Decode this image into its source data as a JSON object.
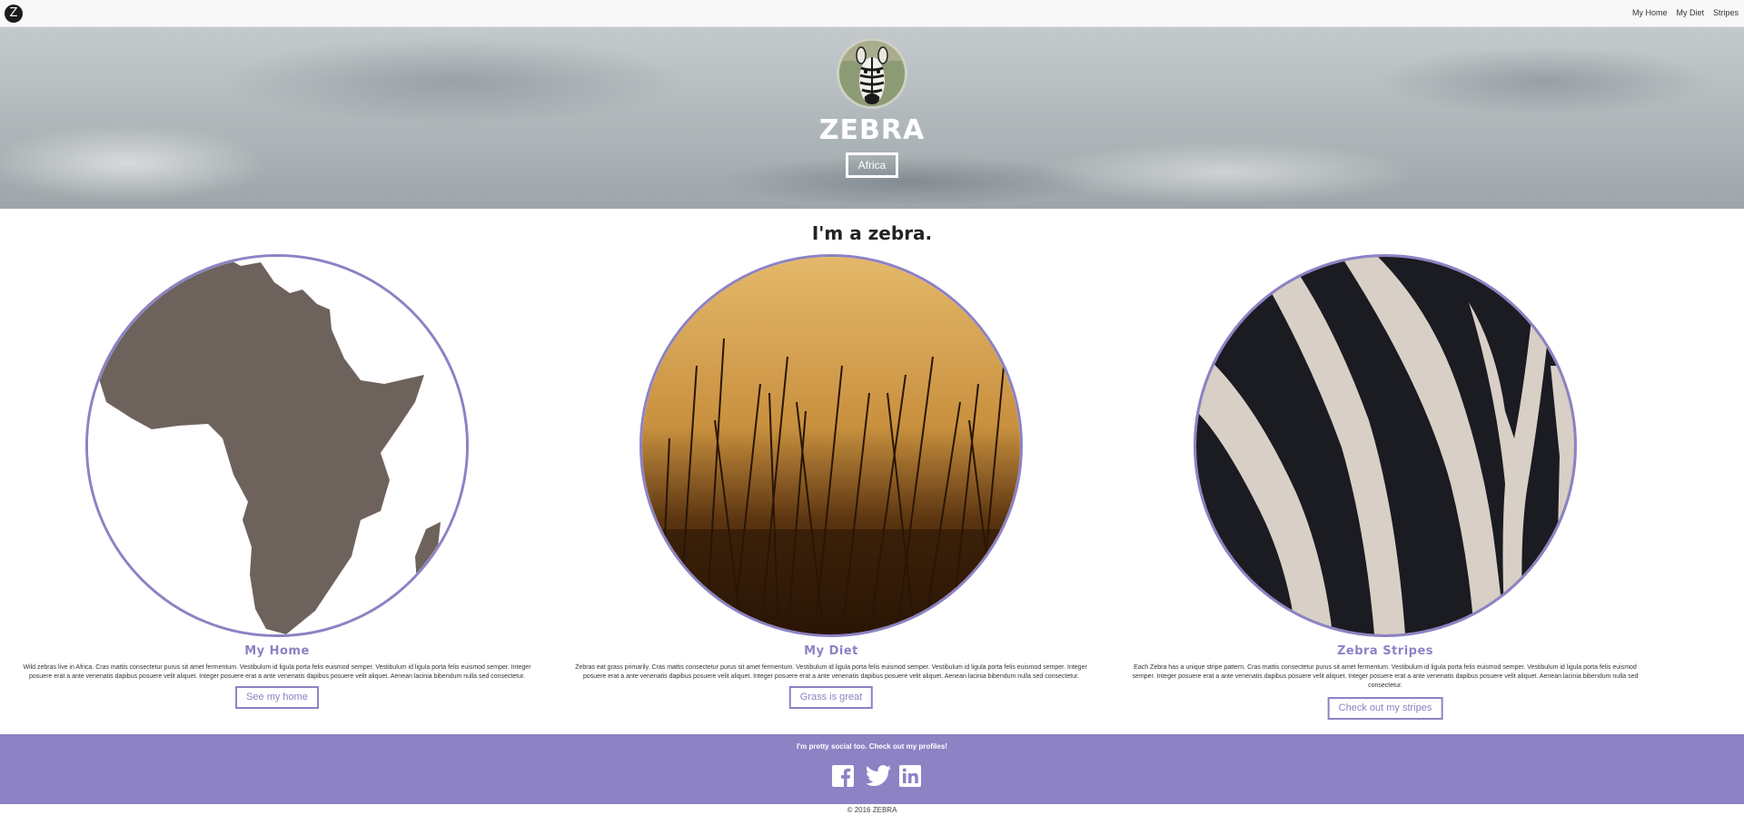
{
  "nav": {
    "logo": "Z",
    "links": [
      "My Home",
      "My Diet",
      "Stripes"
    ]
  },
  "hero": {
    "title": "ZEBRA",
    "button": "Africa"
  },
  "main": {
    "title": "I'm a zebra.",
    "columns": [
      {
        "title": "My Home",
        "text": "Wild zebras live in Africa. Cras mattis consectetur purus sit amet fermentum. Vestibulum id ligula porta felis euismod semper. Vestibulum id ligula porta felis euismod semper. Integer posuere erat a ante venenatis dapibus posuere velit aliquet. Integer posuere erat a ante venenatis dapibus posuere velit aliquet. Aenean lacinia bibendum nulla sed consectetur.",
        "button": "See my home"
      },
      {
        "title": "My Diet",
        "text": "Zebras eat grass primarily. Cras mattis consectetur purus sit amet fermentum. Vestibulum id ligula porta felis euismod semper. Vestibulum id ligula porta felis euismod semper. Integer posuere erat a ante venenatis dapibus posuere velit aliquet. Integer posuere erat a ante venenatis dapibus posuere velit aliquet. Aenean lacinia bibendum nulla sed consectetur.",
        "button": "Grass is great"
      },
      {
        "title": "Zebra Stripes",
        "text": "Each Zebra has a unique stripe pattern. Cras mattis consectetur purus sit amet fermentum. Vestibulum id ligula porta felis euismod semper. Vestibulum id ligula porta felis euismod semper. Integer posuere erat a ante venenatis dapibus posuere velit aliquet. Integer posuere erat a ante venenatis dapibus posuere velit aliquet. Aenean lacinia bibendum nulla sed consectetur.",
        "button": "Check out my stripes"
      }
    ]
  },
  "footer": {
    "text": "I'm pretty social too. Check out my profiles!",
    "icons": [
      "facebook-icon",
      "twitter-icon",
      "linkedin-icon"
    ],
    "copyright": "© 2016 ZEBRA"
  },
  "colors": {
    "accent": "#8c82c4",
    "africa": "#6e625c"
  }
}
